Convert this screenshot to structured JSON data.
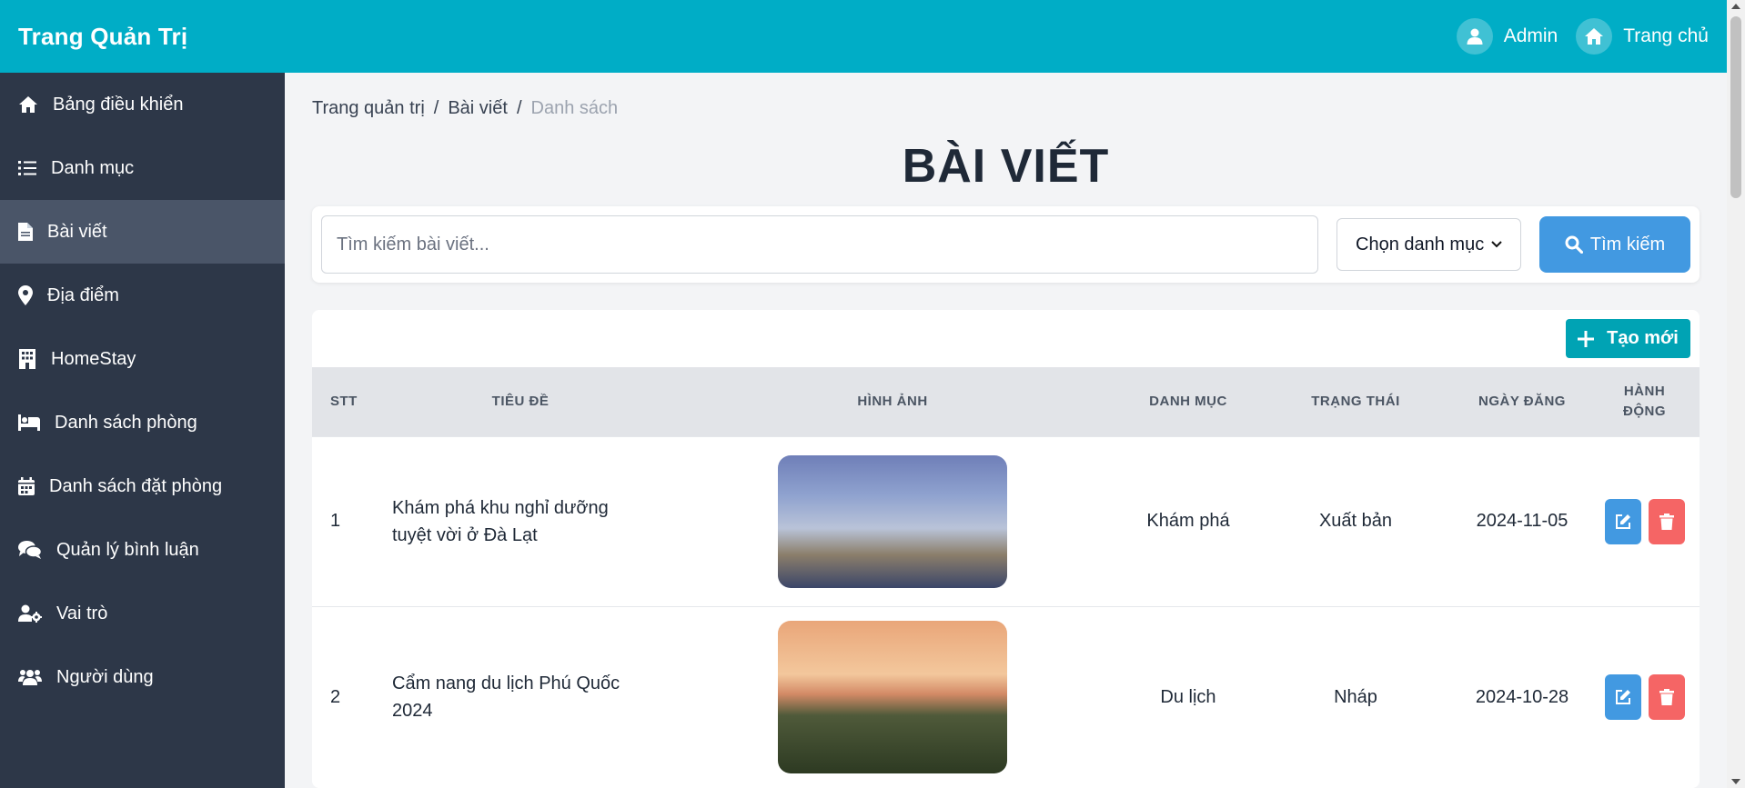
{
  "header": {
    "brand": "Trang Quản Trị",
    "admin_label": "Admin",
    "home_label": "Trang chủ"
  },
  "sidebar": {
    "items": [
      {
        "label": "Bảng điều khiển",
        "icon": "home-icon"
      },
      {
        "label": "Danh mục",
        "icon": "list-icon"
      },
      {
        "label": "Bài viết",
        "icon": "file-icon",
        "active": true
      },
      {
        "label": "Địa điểm",
        "icon": "map-pin-icon"
      },
      {
        "label": "HomeStay",
        "icon": "building-icon"
      },
      {
        "label": "Danh sách phòng",
        "icon": "bed-icon"
      },
      {
        "label": "Danh sách đặt phòng",
        "icon": "calendar-icon"
      },
      {
        "label": "Quản lý bình luận",
        "icon": "comments-icon"
      },
      {
        "label": "Vai trò",
        "icon": "user-gear-icon"
      },
      {
        "label": "Người dùng",
        "icon": "users-icon"
      }
    ]
  },
  "breadcrumb": {
    "items": [
      "Trang quản trị",
      "Bài viết",
      "Danh sách"
    ],
    "separator": "/"
  },
  "page": {
    "title": "BÀI VIẾT"
  },
  "search": {
    "placeholder": "Tìm kiếm bài viết...",
    "category_selected": "Chọn danh mục",
    "button_label": "Tìm kiếm"
  },
  "table": {
    "create_label": "Tạo mới",
    "headers": {
      "stt": "STT",
      "title": "TIÊU ĐỀ",
      "image": "HÌNH ẢNH",
      "category": "DANH MỤC",
      "status": "TRẠNG THÁI",
      "date": "NGÀY ĐĂNG",
      "action_line1": "HÀNH",
      "action_line2": "ĐỘNG"
    },
    "rows": [
      {
        "stt": "1",
        "title_line1": "Khám phá khu nghỉ dưỡng",
        "title_line2": "tuyệt vời ở Đà Lạt",
        "category": "Khám phá",
        "status": "Xuất bản",
        "date": "2024-11-05"
      },
      {
        "stt": "2",
        "title_line1": "Cẩm nang du lịch Phú Quốc",
        "title_line2": "2024",
        "category": "Du lịch",
        "status": "Nháp",
        "date": "2024-10-28"
      }
    ]
  },
  "colors": {
    "topbar": "#00adc6",
    "sidebar": "#2d3748",
    "sidebar_active": "#4a5568",
    "primary": "#4299e1",
    "danger": "#f56565",
    "teal_button": "#00a3b4"
  }
}
